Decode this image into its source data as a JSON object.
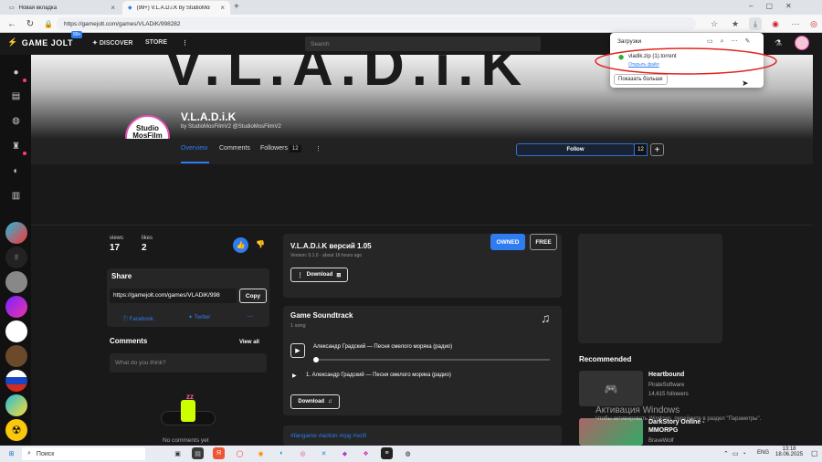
{
  "browser": {
    "tabs": [
      {
        "label": "Новая вкладка"
      },
      {
        "label": "(99+) V.L.A.D.i.K by StudioMosFilmV2"
      }
    ],
    "url": "https://gamejolt.com/games/VLADiK/998282"
  },
  "header": {
    "logo": "GAME JOLT",
    "badge": "99+",
    "nav": [
      "DISCOVER",
      "STORE"
    ],
    "search_placeholder": "Search"
  },
  "downloads": {
    "title": "Загрузки",
    "file_name": "vladik.zip (1).torrent",
    "open_file": "Открыть файл",
    "show_more": "Показать больше"
  },
  "banner": {
    "text": "V.L.A.D.i.K"
  },
  "game": {
    "title": "V.L.A.D.i.K",
    "byline": "by StudioMosFilmV2 @StudioMosFilmV2",
    "avatar_lines": [
      "Studio",
      "MosFilm",
      "V2"
    ]
  },
  "subnav": {
    "overview": "Overview",
    "comments": "Comments",
    "followers": "Followers",
    "followers_count": "12"
  },
  "follow": {
    "label": "Follow",
    "count": "12"
  },
  "stats": {
    "views_label": "views",
    "views": "17",
    "likes_label": "likes",
    "likes": "2"
  },
  "share": {
    "title": "Share",
    "url": "https://gamejolt.com/games/VLADiK/998",
    "copy": "Copy",
    "facebook": "Facebook",
    "twitter": "Twitter"
  },
  "comments": {
    "title": "Comments",
    "view_all": "View all",
    "placeholder": "What do you think?",
    "empty": "No comments yet"
  },
  "build": {
    "title": "V.L.A.D.i.K версий 1.05",
    "version_label": "Version:",
    "version": "0.1.0",
    "time": "about 16 hours ago",
    "download": "Download",
    "owned": "OWNED",
    "free": "FREE"
  },
  "soundtrack": {
    "title": "Game Soundtrack",
    "count": "1 song",
    "track_title": "Александр Градский — Песня смелого моряка (радио)",
    "list_item": "1. Александр Градский — Песня смелого моряка (радио)",
    "download": "Download"
  },
  "tags": "#fangame #action #rpg #scifi",
  "recommended": {
    "title": "Recommended",
    "items": [
      {
        "name": "Heartbound",
        "author": "PirateSoftware",
        "followers": "14,615 followers"
      },
      {
        "name": "DarkStory Online - MMORPG",
        "author": "BraveWolf"
      }
    ]
  },
  "watermark": {
    "line1": "Активация Windows",
    "line2": "Чтобы активировать Windows, перейдите в раздел \"Параметры\"."
  },
  "taskbar": {
    "search": "Поиск",
    "lang": "ENG",
    "time": "13:18",
    "date": "18.06.2025"
  },
  "colors": {
    "accent": "#2f7cf0",
    "owned": "#2f7cf0",
    "panel": "#262626"
  }
}
